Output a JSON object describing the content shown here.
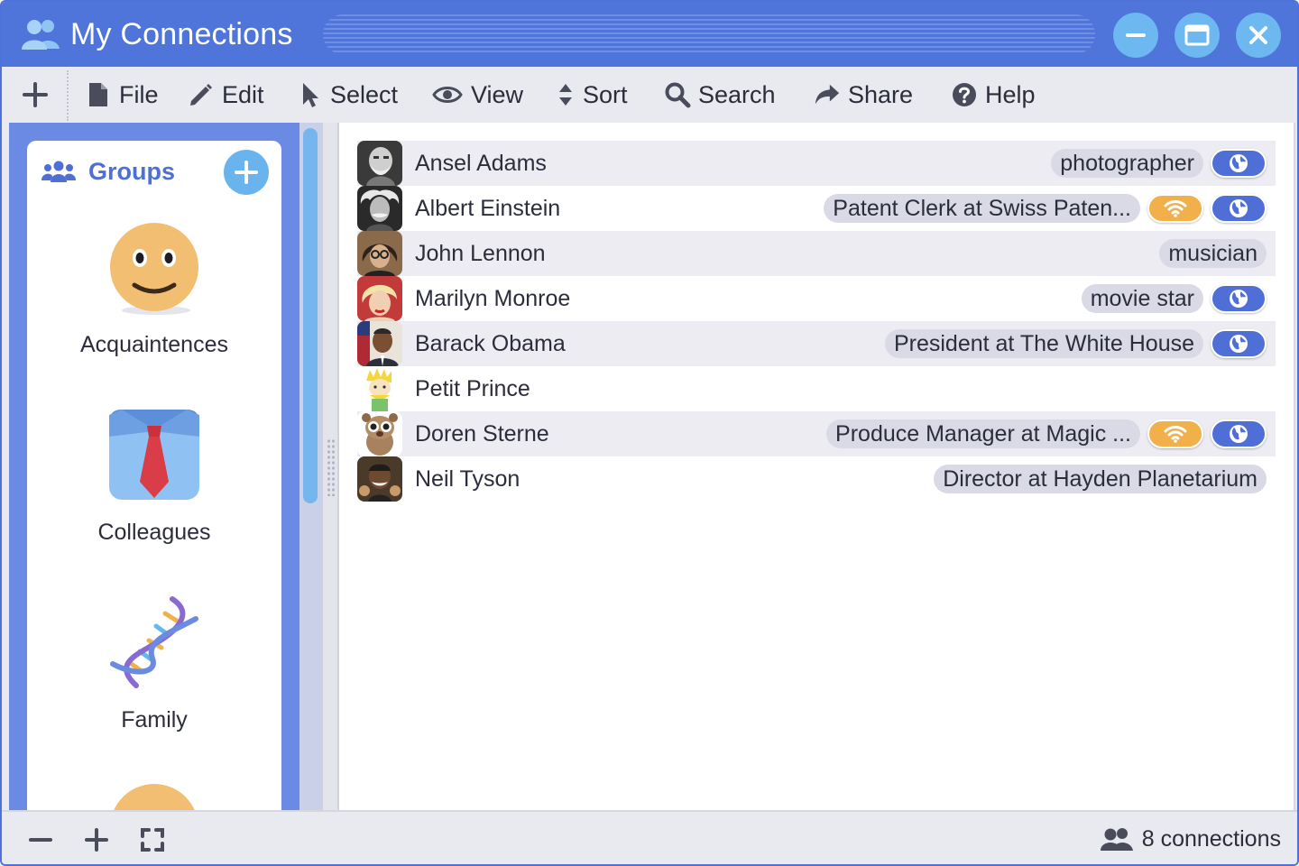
{
  "window": {
    "title": "My Connections",
    "icon": "people-icon",
    "controls": [
      "minimize-icon",
      "maximize-icon",
      "close-icon"
    ],
    "accent": "#4f74da"
  },
  "menu": {
    "add_icon": "plus-icon",
    "items": [
      {
        "label": "File",
        "icon": "file-icon"
      },
      {
        "label": "Edit",
        "icon": "pencil-icon"
      },
      {
        "label": "Select",
        "icon": "cursor-icon"
      },
      {
        "label": "View",
        "icon": "eye-icon"
      },
      {
        "label": "Sort",
        "icon": "sort-icon"
      },
      {
        "label": "Search",
        "icon": "search-icon"
      },
      {
        "label": "Share",
        "icon": "share-icon"
      },
      {
        "label": "Help",
        "icon": "help-icon"
      }
    ]
  },
  "sidebar": {
    "title": "Groups",
    "groups": [
      {
        "label": "Acquaintences",
        "icon": "smiley-face-icon"
      },
      {
        "label": "Colleagues",
        "icon": "shirt-tie-icon"
      },
      {
        "label": "Family",
        "icon": "dna-icon"
      }
    ]
  },
  "connections": [
    {
      "name": "Ansel Adams",
      "tag": "photographer",
      "wifi": false,
      "web": true,
      "avatar": "ansel-adams-photo"
    },
    {
      "name": "Albert Einstein",
      "tag": "Patent Clerk at Swiss Paten...",
      "wifi": true,
      "web": true,
      "avatar": "albert-einstein-photo"
    },
    {
      "name": "John Lennon",
      "tag": "musician",
      "wifi": false,
      "web": false,
      "avatar": "john-lennon-photo"
    },
    {
      "name": "Marilyn Monroe",
      "tag": "movie star",
      "wifi": false,
      "web": true,
      "avatar": "marilyn-monroe-photo"
    },
    {
      "name": "Barack Obama",
      "tag": "President at The White House",
      "wifi": false,
      "web": true,
      "avatar": "barack-obama-photo"
    },
    {
      "name": "Petit Prince",
      "tag": "",
      "wifi": false,
      "web": false,
      "avatar": "petit-prince-drawing"
    },
    {
      "name": "Doren Sterne",
      "tag": "Produce Manager at Magic ...",
      "wifi": true,
      "web": true,
      "avatar": "doren-sterne-animal"
    },
    {
      "name": "Neil Tyson",
      "tag": "Director at Hayden Planetarium",
      "wifi": false,
      "web": false,
      "avatar": "neil-tyson-photo"
    }
  ],
  "statusbar": {
    "zoom_out_icon": "minus-icon",
    "zoom_in_icon": "plus-icon",
    "fit_icon": "fullscreen-icon",
    "count_text": "8 connections"
  }
}
